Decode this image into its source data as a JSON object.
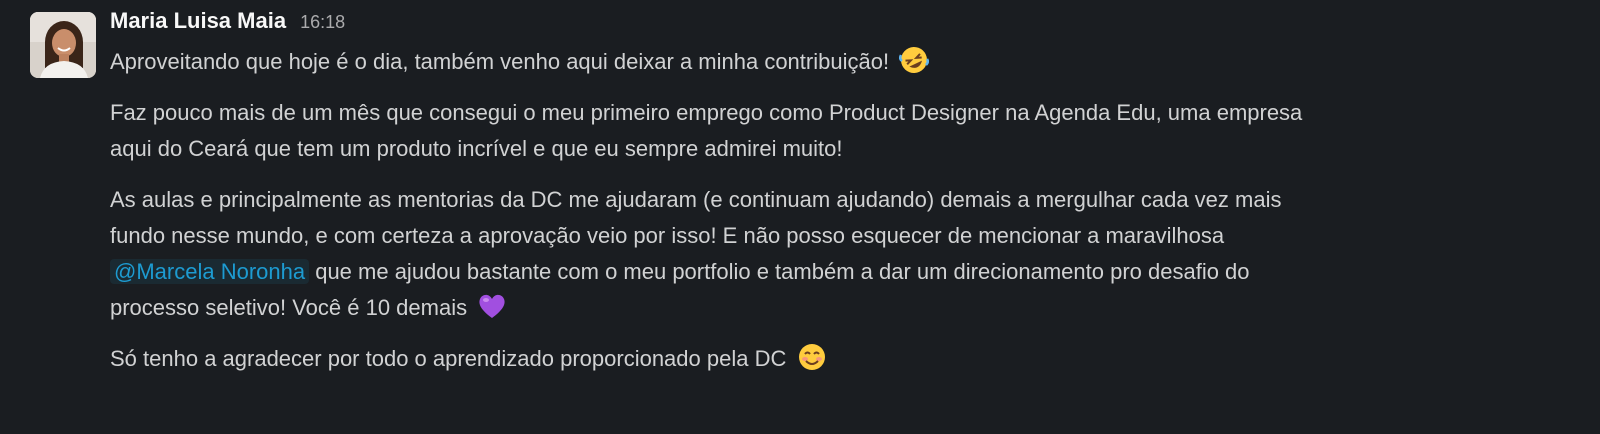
{
  "message": {
    "author": "Maria Luisa Maia",
    "time": "16:18",
    "avatar_icon": "user-avatar-photo",
    "paragraphs": {
      "p1": "Aproveitando que hoje é o dia, também venho aqui deixar a minha contribuição!",
      "p1_emoji": "rolling-on-floor-laughing-emoji",
      "p2_line1": "Faz pouco mais de um mês que consegui o meu primeiro emprego como Product Designer na Agenda Edu, uma empresa",
      "p2_line2": "aqui do Ceará que tem um produto incrível e que eu sempre admirei muito!",
      "p3_line1": "As aulas e principalmente as mentorias da DC me ajudaram (e continuam ajudando) demais a mergulhar cada vez mais",
      "p3_line2": "fundo nesse mundo, e com certeza a aprovação veio por isso! E não posso esquecer de mencionar a maravilhosa",
      "p3_mention": "@Marcela Noronha",
      "p3_line3_after": " que me ajudou bastante com o meu portfolio e também a dar um direcionamento pro desafio do",
      "p3_line4": "processo seletivo! Você é 10 demais",
      "p3_emoji": "purple-heart-emoji",
      "p4": "Só tenho a agradecer por todo o aprendizado proporcionado pela DC",
      "p4_emoji": "smiling-face-emoji"
    }
  },
  "colors": {
    "background": "#1a1d21",
    "text": "#d1d2d3",
    "author": "#f8f8f8",
    "timestamp": "#ababad",
    "mention": "#1d9bd1"
  }
}
